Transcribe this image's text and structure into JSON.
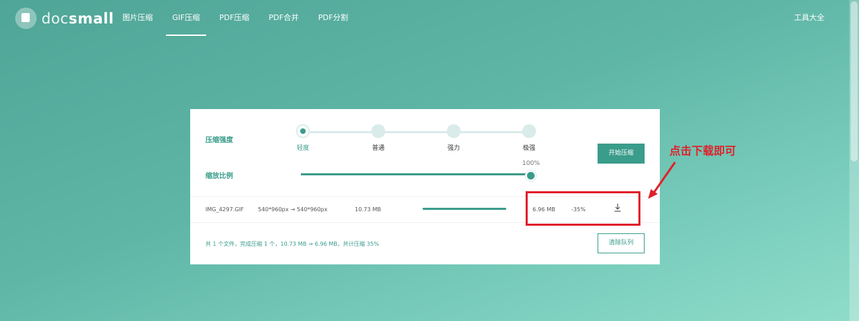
{
  "header": {
    "logo_text_thin": "doc",
    "logo_text_bold": "small",
    "nav": [
      {
        "label": "图片压缩",
        "active": false
      },
      {
        "label": "GIF压缩",
        "active": true
      },
      {
        "label": "PDF压缩",
        "active": false
      },
      {
        "label": "PDF合并",
        "active": false
      },
      {
        "label": "PDF分割",
        "active": false
      }
    ],
    "tools_label": "工具大全"
  },
  "compressor": {
    "strength_label": "压缩强度",
    "levels": [
      "轻度",
      "普通",
      "强力",
      "极强"
    ],
    "selected_level": "轻度",
    "scale_label": "缩放比例",
    "scale_value": "100%",
    "start_button": "开始压缩"
  },
  "file": {
    "name": "IMG_4297.GIF",
    "dimensions": "540*960px → 540*960px",
    "original_size": "10.73 MB",
    "progress": 1.0,
    "compressed_size": "6.96 MB",
    "reduction": "-35%"
  },
  "footer": {
    "summary": "共 1 个文件，完成压缩 1 个，10.73 MB → 6.96 MB，共计压缩 35%",
    "clear_button": "清除队列"
  },
  "annotation": {
    "text": "点击下载即可",
    "color": "#e0202a"
  },
  "colors": {
    "accent": "#3a9c8b",
    "annotation_red": "#e0202a"
  }
}
